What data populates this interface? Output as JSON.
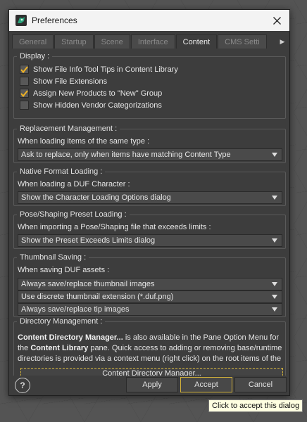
{
  "window": {
    "title": "Preferences",
    "close_icon": "close-icon",
    "app_icon": "daz-logo-icon"
  },
  "tabs": [
    "General",
    "Startup",
    "Scene",
    "Interface",
    "Content",
    "CMS Setti"
  ],
  "active_tab": "Content",
  "display": {
    "legend": "Display :",
    "items": [
      {
        "label": "Show File Info Tool Tips in Content Library",
        "checked": true
      },
      {
        "label": "Show File Extensions",
        "checked": false
      },
      {
        "label": "Assign New Products to \"New\" Group",
        "checked": true
      },
      {
        "label": "Show Hidden Vendor Categorizations",
        "checked": false
      }
    ]
  },
  "replacement": {
    "legend": "Replacement Management :",
    "label": "When loading items of the same type :",
    "value": "Ask to replace, only when items have matching Content Type"
  },
  "native_format": {
    "legend": "Native Format Loading :",
    "label": "When loading a DUF Character :",
    "value": "Show the Character Loading Options dialog"
  },
  "pose_shaping": {
    "legend": "Pose/Shaping Preset Loading :",
    "label": "When importing a Pose/Shaping file that exceeds limits :",
    "value": "Show the Preset Exceeds Limits dialog"
  },
  "thumbnail": {
    "legend": "Thumbnail Saving :",
    "label": "When saving DUF assets :",
    "values": [
      "Always save/replace thumbnail images",
      "Use discrete thumbnail extension (*.duf.png)",
      "Always save/replace tip images"
    ]
  },
  "directory": {
    "legend": "Directory Management :",
    "p1_bold": "Content Directory Manager...",
    "p1_rest": " is also available in the Pane Option Menu for the ",
    "p2_bold": "Content Library",
    "p2_rest": " pane. Quick access to adding or removing base/runtime directories is provided via a context menu (right click) on the root items of the",
    "button": "Content Directory Manager..."
  },
  "footer": {
    "help": "?",
    "apply": "Apply",
    "accept": "Accept",
    "cancel": "Cancel"
  },
  "tooltip": "Click to accept this dialog",
  "colors": {
    "accent": "#d2b13b",
    "check": "#f0b323",
    "logo": "#29a37a"
  }
}
